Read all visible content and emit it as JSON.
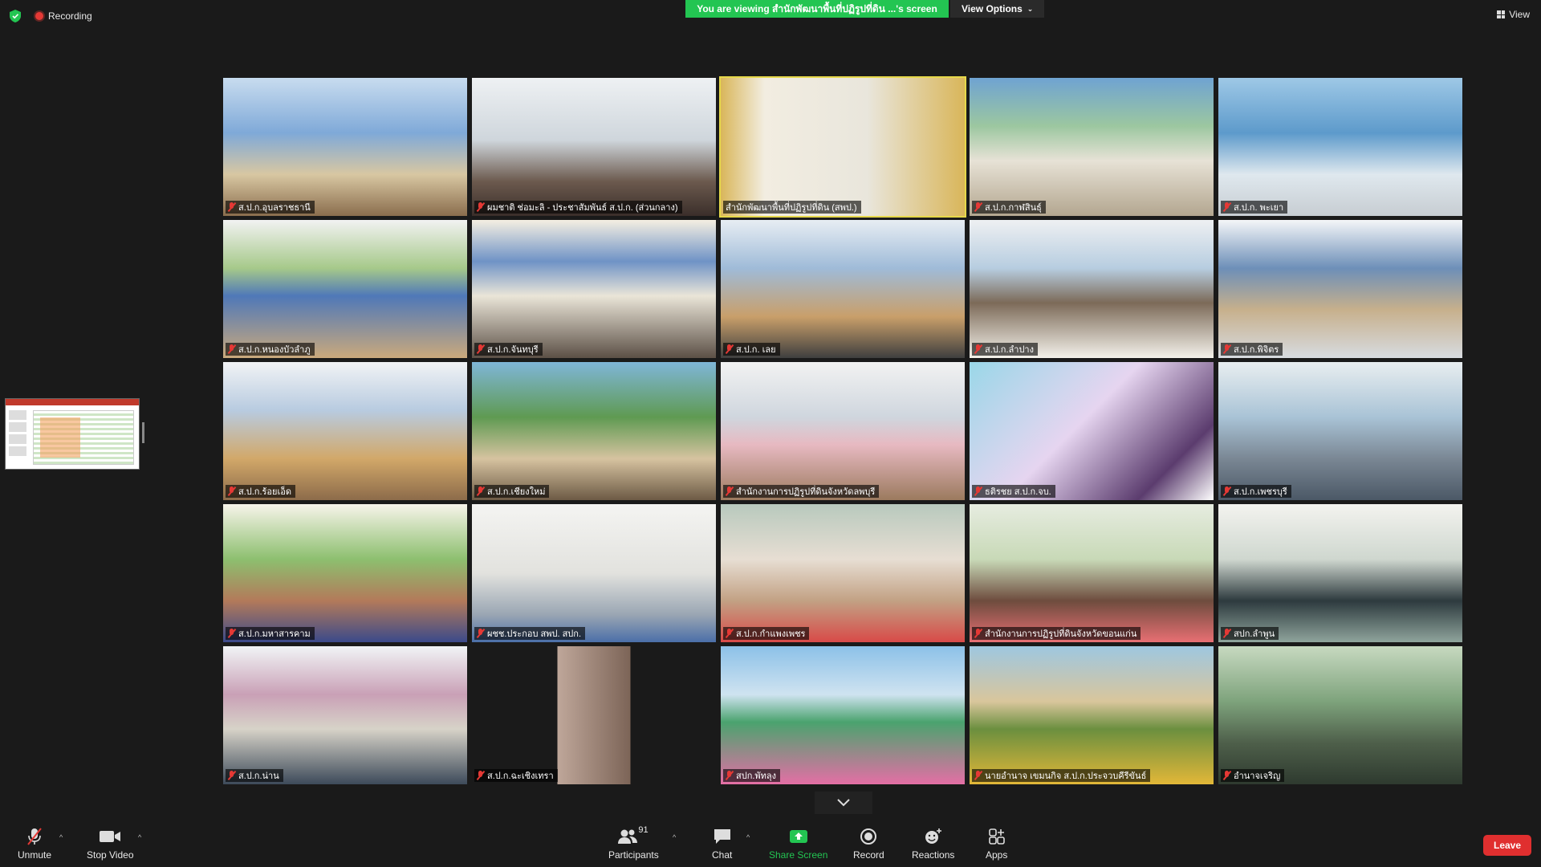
{
  "top_bar": {
    "recording_label": "Recording",
    "viewing_banner": "You are viewing สำนักพัฒนาพื้นที่ปฏิรูปที่ดิน ...'s screen",
    "view_options_label": "View Options",
    "view_label": "View"
  },
  "participants_tiles": [
    {
      "name": "ส.ป.ก.อุบลราชธานี",
      "muted": true
    },
    {
      "name": "ผมชาติ ช่อมะลิ - ประชาสัมพันธ์ ส.ป.ก. (ส่วนกลาง)",
      "muted": true
    },
    {
      "name": "สำนักพัฒนาพื้นที่ปฏิรูปที่ดิน (สพป.)",
      "muted": false
    },
    {
      "name": "ส.ป.ก.กาฬสินธุ์",
      "muted": true
    },
    {
      "name": "ส.ป.ก. พะเยา",
      "muted": true
    },
    {
      "name": "ส.ป.ก.หนองบัวลำภู",
      "muted": true
    },
    {
      "name": "ส.ป.ก.จันทบุรี",
      "muted": true
    },
    {
      "name": "ส.ป.ก. เลย",
      "muted": true
    },
    {
      "name": "ส.ป.ก.ลำปาง",
      "muted": true
    },
    {
      "name": "ส.ป.ก.พิจิตร",
      "muted": true
    },
    {
      "name": "ส.ป.ก.ร้อยเอ็ด",
      "muted": true
    },
    {
      "name": "ส.ป.ก.เชียงใหม่",
      "muted": true
    },
    {
      "name": "สำนักงานการปฏิรูปที่ดินจังหวัดลพบุรี",
      "muted": true
    },
    {
      "name": "ธติรชย ส.ป.ก.จบ.",
      "muted": true
    },
    {
      "name": "ส.ป.ก.เพชรบุรี",
      "muted": true
    },
    {
      "name": "ส.ป.ก.มหาสารคาม",
      "muted": true
    },
    {
      "name": "ผชช.ประกอบ สพป. สปก.",
      "muted": true
    },
    {
      "name": "ส.ป.ก.กำแพงเพชร",
      "muted": true
    },
    {
      "name": "สำนักงานการปฏิรูปที่ดินจังหวัดขอนแก่น",
      "muted": true
    },
    {
      "name": "สปก.ลำพูน",
      "muted": true
    },
    {
      "name": "ส.ป.ก.น่าน",
      "muted": true
    },
    {
      "name": "ส.ป.ก.ฉะเชิงเทรา",
      "muted": true
    },
    {
      "name": "สปก.พัทลุง",
      "muted": true
    },
    {
      "name": "นายอำนาจ เขมนกิจ ส.ป.ก.ประจวบคีรีขันธ์",
      "muted": true
    },
    {
      "name": "อำนาจเจริญ",
      "muted": true
    }
  ],
  "toolbar": {
    "unmute_label": "Unmute",
    "stop_video_label": "Stop Video",
    "participants_label": "Participants",
    "participants_count": "91",
    "chat_label": "Chat",
    "share_screen_label": "Share Screen",
    "record_label": "Record",
    "reactions_label": "Reactions",
    "apps_label": "Apps",
    "leave_label": "Leave"
  },
  "colors": {
    "banner_green": "#23c552",
    "leave_red": "#e02f2f",
    "active_speaker_outline": "#e6d84a",
    "muted_red": "#e53935"
  }
}
